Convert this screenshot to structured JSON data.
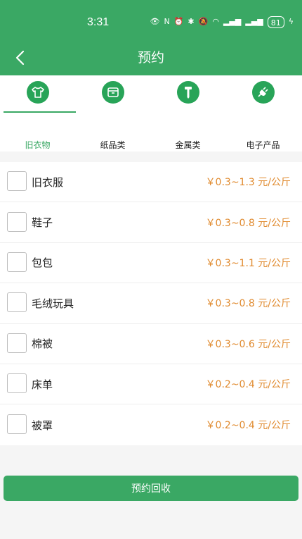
{
  "status_bar": {
    "time": "3:31",
    "battery": "81"
  },
  "header": {
    "title": "预约",
    "bg_color": "#3aa864"
  },
  "tabs": [
    {
      "label": "旧衣物",
      "icon": "shirt-icon",
      "active": true
    },
    {
      "label": "纸品类",
      "icon": "box-icon",
      "active": false
    },
    {
      "label": "金属类",
      "icon": "screw-icon",
      "active": false
    },
    {
      "label": "电子产品",
      "icon": "plug-icon",
      "active": false
    }
  ],
  "items": [
    {
      "name": "旧衣服",
      "price": "￥0.3~1.3 元/公斤"
    },
    {
      "name": "鞋子",
      "price": "￥0.3~0.8 元/公斤"
    },
    {
      "name": "包包",
      "price": "￥0.3~1.1 元/公斤"
    },
    {
      "name": "毛绒玩具",
      "price": "￥0.3~0.8 元/公斤"
    },
    {
      "name": "棉被",
      "price": "￥0.3~0.6 元/公斤"
    },
    {
      "name": "床单",
      "price": "￥0.2~0.4 元/公斤"
    },
    {
      "name": "被罩",
      "price": "￥0.2~0.4 元/公斤"
    }
  ],
  "submit": {
    "label": "预约回收"
  },
  "colors": {
    "accent": "#3aa864",
    "price": "#e08a2e"
  }
}
